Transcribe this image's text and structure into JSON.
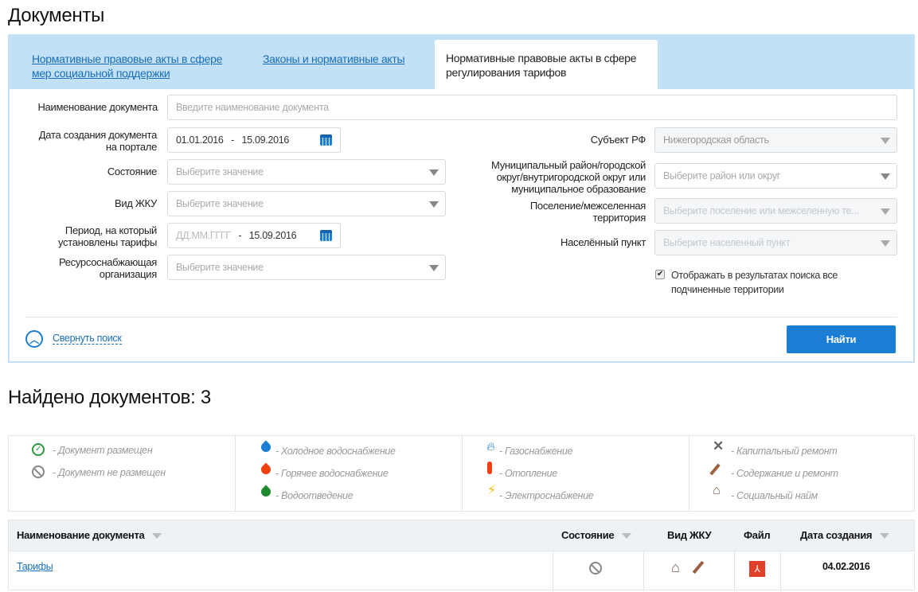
{
  "page_title": "Документы",
  "tabs": [
    {
      "label": "Нормативные правовые акты в сфере мер социальной поддержки"
    },
    {
      "label": "Законы и нормативные акты"
    },
    {
      "label": "Нормативные правовые акты в сфере регулирования тарифов"
    }
  ],
  "form": {
    "doc_name": {
      "label": "Наименование документа",
      "placeholder": "Введите наименование документа"
    },
    "created": {
      "label": "Дата создания документа на портале",
      "from": "01.01.2016",
      "sep": "-",
      "to": "15.09.2016"
    },
    "state": {
      "label": "Состояние",
      "placeholder": "Выберите значение"
    },
    "zhku": {
      "label": "Вид ЖКУ",
      "placeholder": "Выберите значение"
    },
    "period": {
      "label": "Период, на который установлены тарифы",
      "from_placeholder": "ДД.ММ.ГГГГ",
      "sep": "-",
      "to": "15.09.2016"
    },
    "org": {
      "label": "Ресурсоснабжающая организация",
      "placeholder": "Выберите значение"
    },
    "subject": {
      "label": "Субъект РФ",
      "value": "Нижегородская область"
    },
    "district": {
      "label": "Муниципальный район/городской округ/внутригородской округ или муниципальное образование",
      "placeholder": "Выберите район или округ"
    },
    "settlement": {
      "label": "Поселение/межселенная территория",
      "placeholder": "Выберите поселение или межселенную те..."
    },
    "locality": {
      "label": "Населённый пункт",
      "placeholder": "Выберите населенный пункт"
    },
    "show_sub": {
      "label": "Отображать в результатах поиска все подчиненные территории",
      "checked": true
    },
    "collapse": "Свернуть поиск",
    "find": "Найти"
  },
  "found": "Найдено документов: 3",
  "legend": [
    {
      "icon": "check-circle",
      "text": "- Документ размещен"
    },
    {
      "icon": "ban",
      "text": "- Документ не размещен"
    },
    {
      "icon": "drop-blue",
      "text": "- Холодное водоснабжение"
    },
    {
      "icon": "drop-red",
      "text": "- Горячее водоснабжение"
    },
    {
      "icon": "drop-green",
      "text": "- Водоотведение"
    },
    {
      "icon": "flame",
      "text": "- Газоснабжение"
    },
    {
      "icon": "thermometer",
      "text": "- Отопление"
    },
    {
      "icon": "bolt",
      "text": "- Электроснабжение"
    },
    {
      "icon": "tools",
      "text": "- Капитальный ремонт"
    },
    {
      "icon": "broom",
      "text": "- Содержание и ремонт"
    },
    {
      "icon": "house",
      "text": "- Социальный найм"
    }
  ],
  "table": {
    "headers": [
      "Наименование документа",
      "Состояние",
      "Вид ЖКУ",
      "Файл",
      "Дата создания"
    ],
    "rows": [
      {
        "name": "Тарифы",
        "state": "ban",
        "zhku": [
          "house",
          "broom"
        ],
        "file": "pdf",
        "date": "04.02.2016"
      }
    ]
  },
  "colors": {
    "accent": "#1a7fd4",
    "tabbar": "#c2e0f6",
    "link": "#1a6fb8"
  }
}
